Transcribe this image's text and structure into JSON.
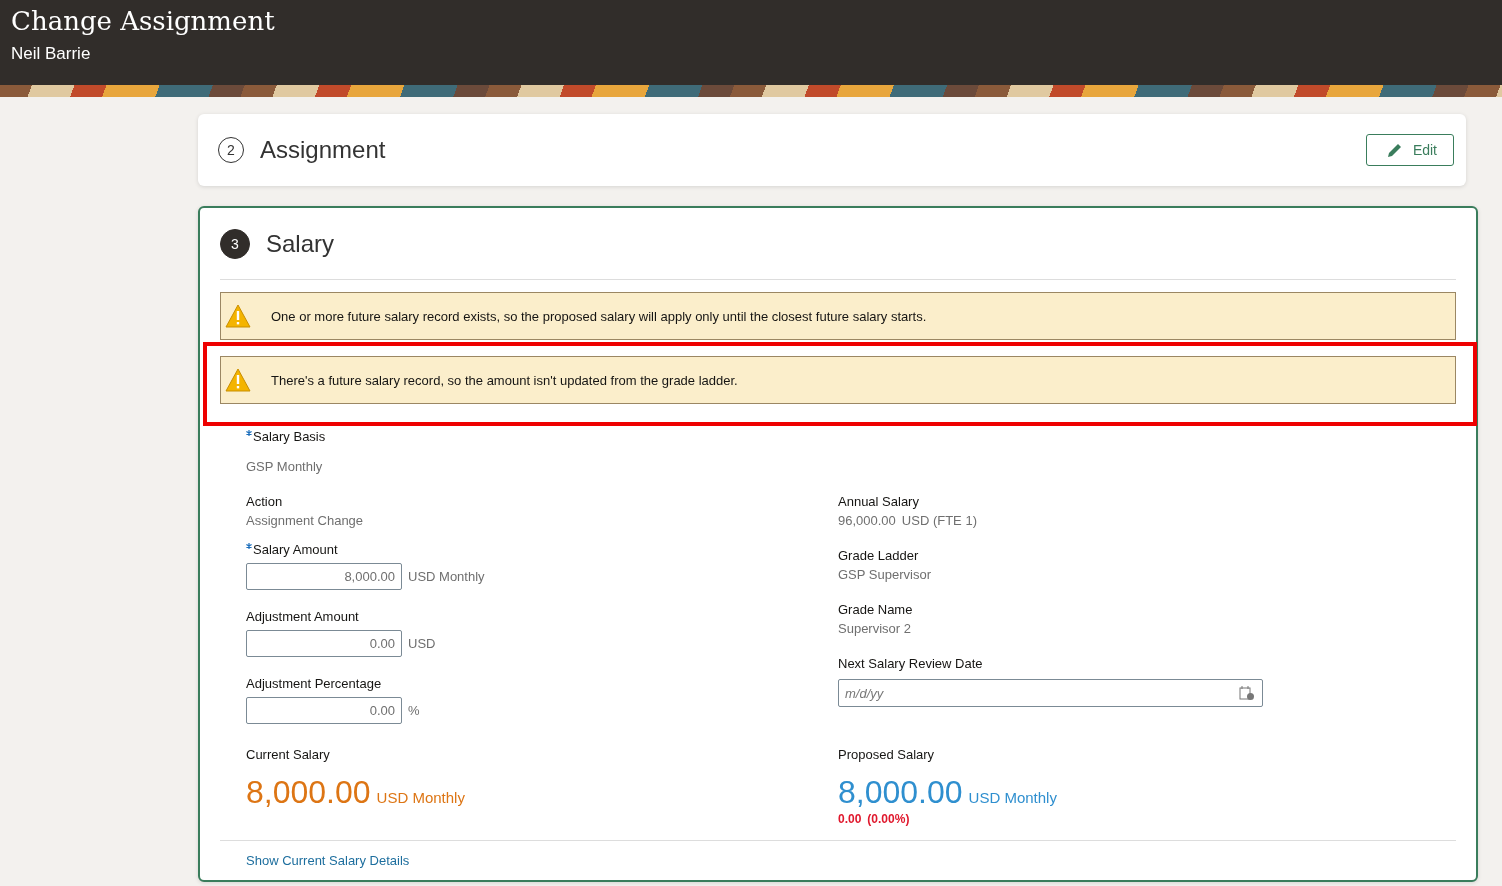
{
  "header": {
    "title": "Change Assignment",
    "subtitle": "Neil Barrie"
  },
  "sections": [
    {
      "number": "2",
      "title": "Assignment",
      "active": false,
      "edit_button": "Edit"
    },
    {
      "number": "3",
      "title": "Salary",
      "active": true
    }
  ],
  "warnings": [
    {
      "text": "One or more future salary record exists, so the proposed salary will apply only until the closest future salary starts.",
      "highlighted": false
    },
    {
      "text": "There's a future salary record, so the amount isn't updated from the grade ladder.",
      "highlighted": true
    }
  ],
  "salary_basis": {
    "label": "Salary Basis",
    "required": true,
    "value": "GSP Monthly"
  },
  "left_fields": [
    {
      "kind": "readonly",
      "label": "Action",
      "required": false,
      "value": "Assignment Change"
    },
    {
      "kind": "number",
      "label": "Salary Amount",
      "required": true,
      "value": "8,000.00",
      "unit": "USD Monthly"
    },
    {
      "kind": "number",
      "label": "Adjustment Amount",
      "required": false,
      "value": "0.00",
      "unit": "USD"
    },
    {
      "kind": "number",
      "label": "Adjustment Percentage",
      "required": false,
      "value": "0.00",
      "unit": "%"
    }
  ],
  "right_fields": [
    {
      "kind": "readonly",
      "label": "Annual Salary",
      "value": "96,000.00",
      "unit": "USD (FTE 1)"
    },
    {
      "kind": "readonly",
      "label": "Grade Ladder",
      "value": "GSP Supervisor"
    },
    {
      "kind": "readonly",
      "label": "Grade Name",
      "value": "Supervisor 2"
    },
    {
      "kind": "date",
      "label": "Next Salary Review Date",
      "placeholder": "m/d/yy"
    }
  ],
  "current_salary": {
    "label": "Current Salary",
    "amount": "8,000.00",
    "unit": "USD Monthly"
  },
  "proposed_salary": {
    "label": "Proposed Salary",
    "amount": "8,000.00",
    "unit": "USD Monthly",
    "change": "0.00",
    "change_percent": "(0.00%)"
  },
  "link": "Show Current Salary Details"
}
